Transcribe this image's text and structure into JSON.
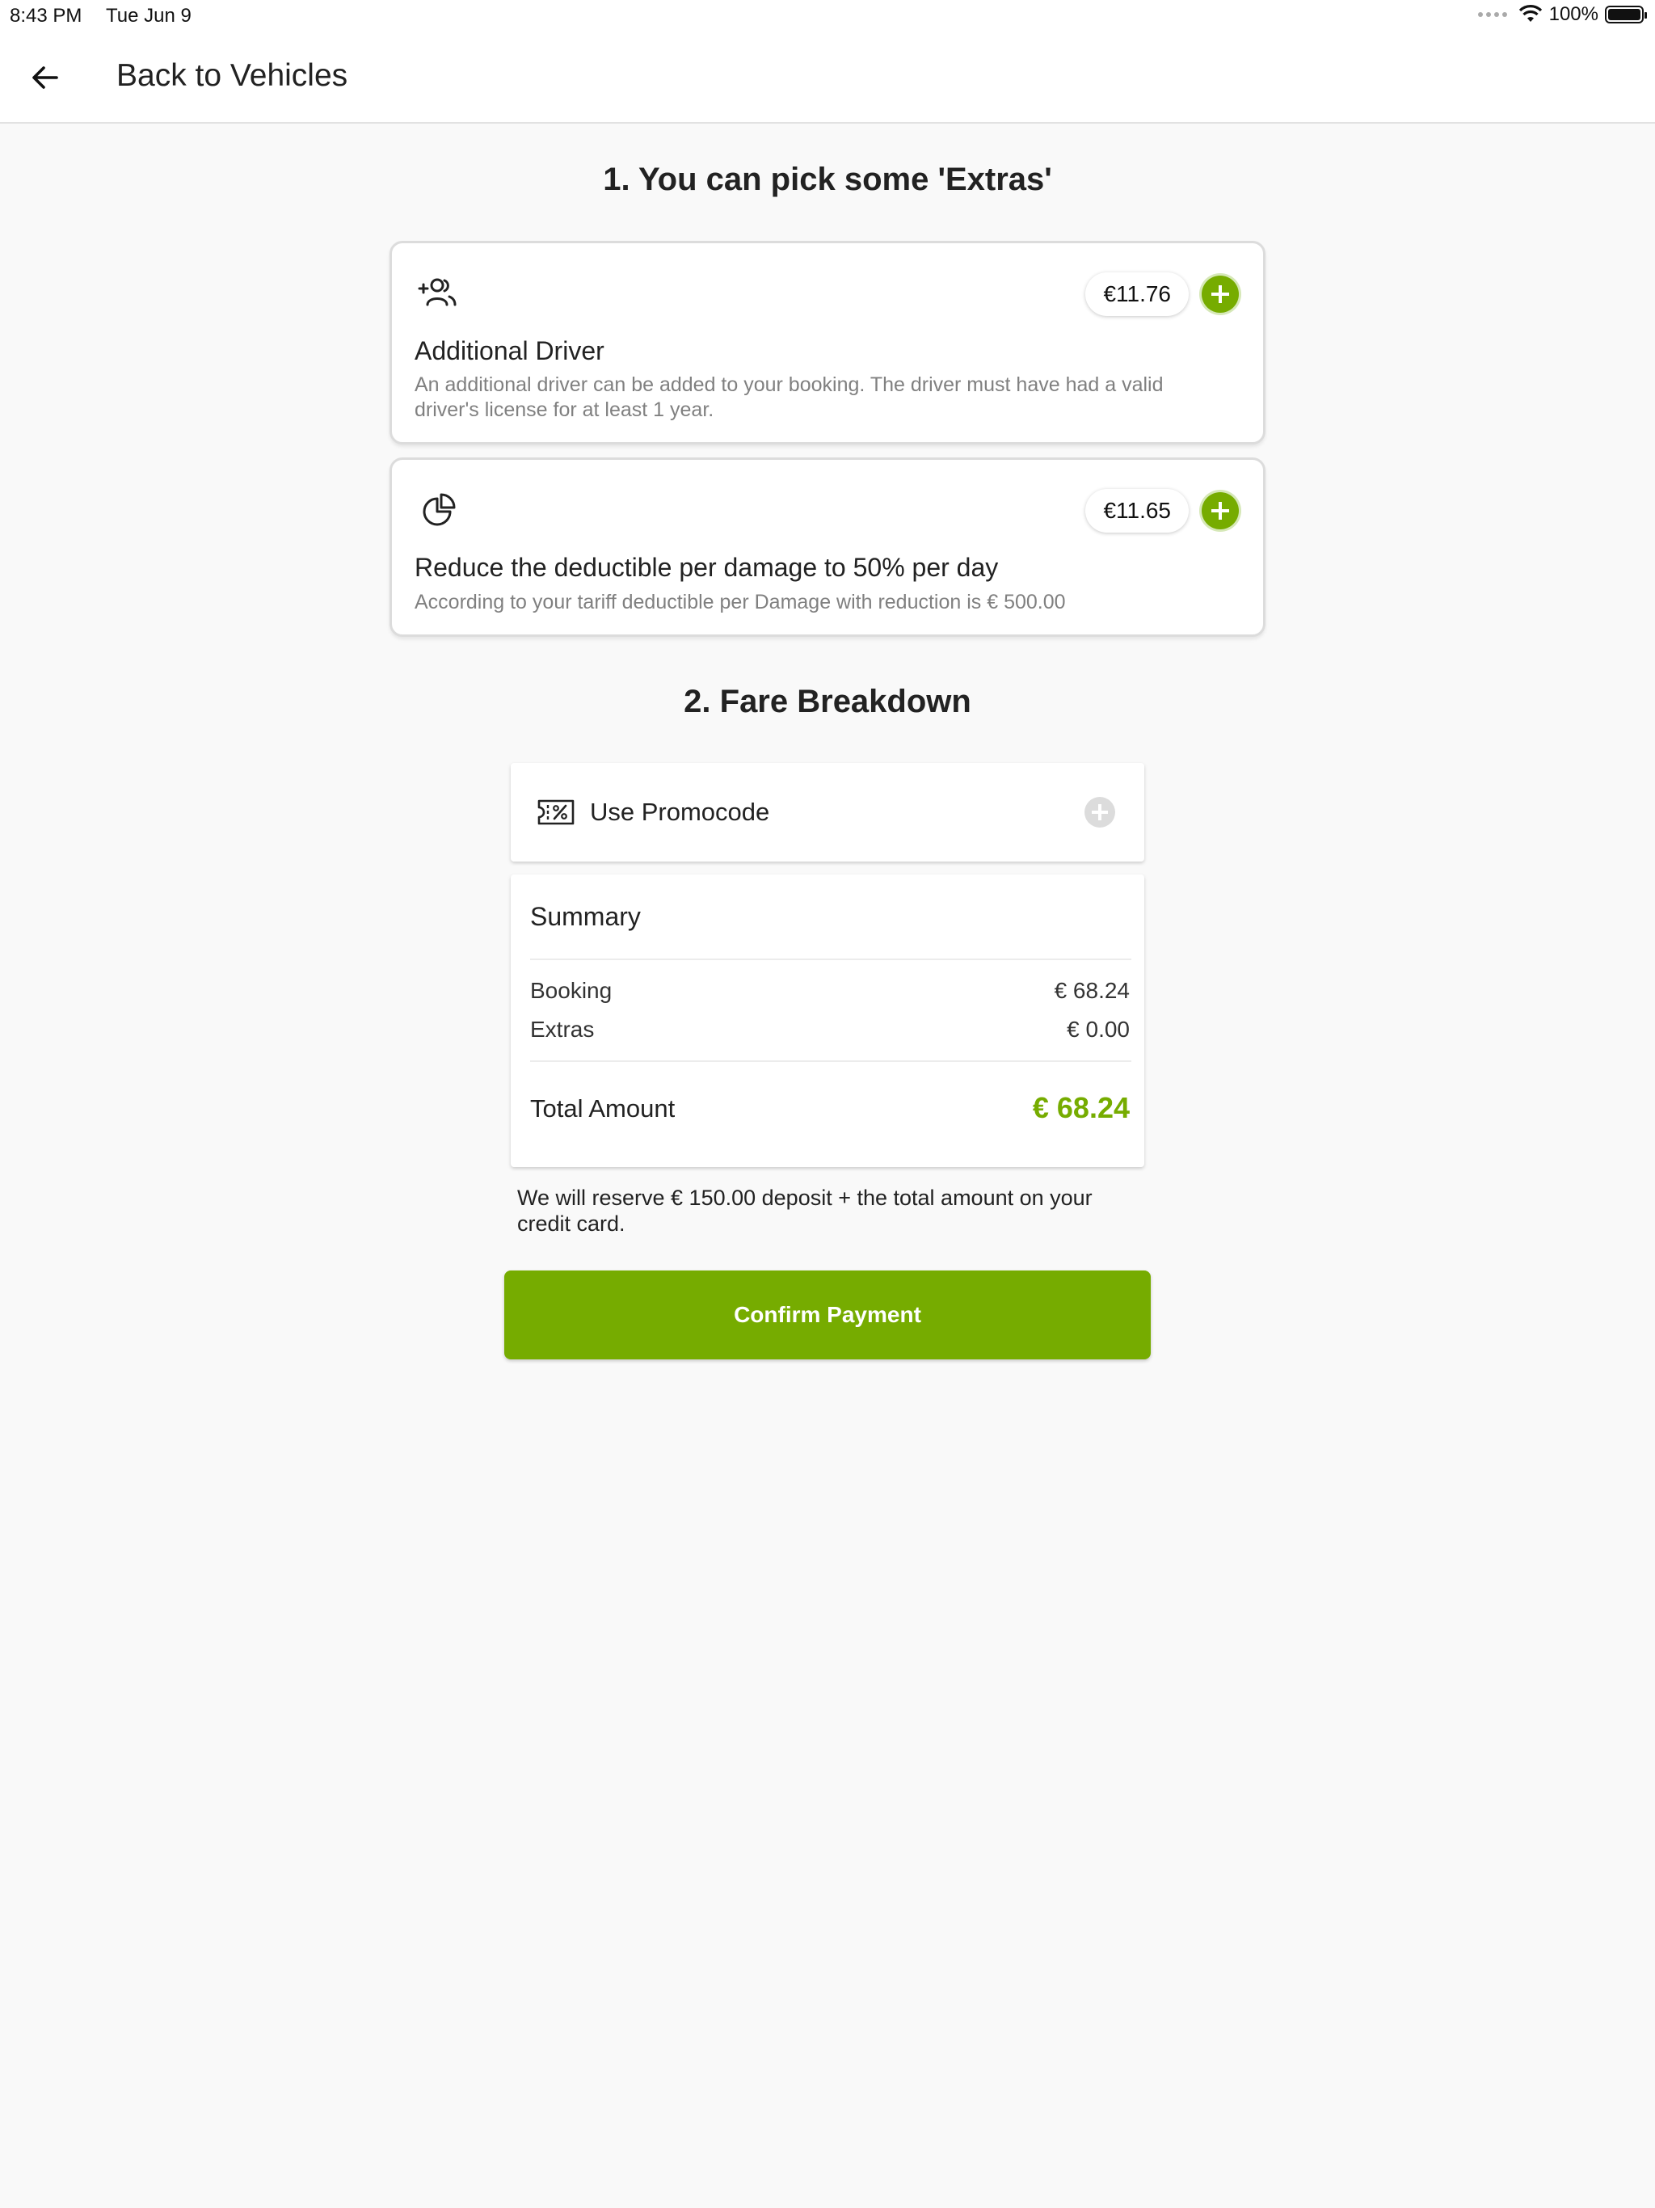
{
  "status_bar": {
    "time": "8:43 PM",
    "date": "Tue Jun 9",
    "battery": "100%"
  },
  "header": {
    "back_label": "Back to Vehicles"
  },
  "extras_section": {
    "title": "1. You can pick some 'Extras'",
    "items": [
      {
        "icon": "add-person-icon",
        "name": "Additional Driver",
        "description": "An additional driver can be added to your booking. The driver must have had a valid driver's license for at least 1 year.",
        "price": "€11.76"
      },
      {
        "icon": "pie-chart-icon",
        "name": "Reduce the deductible per damage to 50% per day",
        "description": "According to your tariff deductible per Damage with reduction is € 500.00",
        "price": "€11.65"
      }
    ]
  },
  "fare_section": {
    "title": "2. Fare Breakdown",
    "promo_label": "Use Promocode",
    "summary": {
      "title": "Summary",
      "rows": [
        {
          "label": "Booking",
          "value": "€ 68.24"
        },
        {
          "label": "Extras",
          "value": "€ 0.00"
        }
      ],
      "total_label": "Total Amount",
      "total_value": "€ 68.24"
    },
    "deposit_note": "We will reserve € 150.00 deposit + the total amount on your credit card.",
    "confirm_label": "Confirm Payment"
  },
  "colors": {
    "accent": "#76ac00",
    "background": "#f9f9f9"
  }
}
